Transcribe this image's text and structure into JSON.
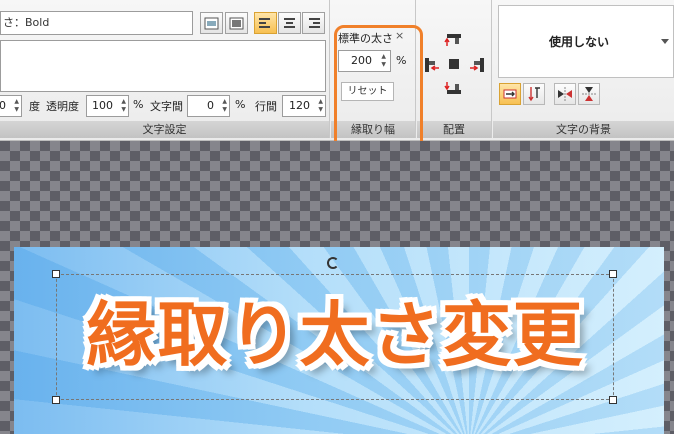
{
  "text_settings": {
    "font_value": "さ：Bold",
    "line3": {
      "angle_value": "0",
      "angle_unit": "度",
      "opacity_label": "透明度",
      "opacity_value": "100",
      "opacity_unit": "%",
      "spacing_label": "文字間",
      "spacing_value": "0",
      "spacing_unit": "%",
      "line_spacing_label": "行間",
      "line_spacing_value": "120"
    },
    "group_label": "文字設定"
  },
  "outline_width": {
    "title": "標準の太さ",
    "close": "×",
    "value": "200",
    "unit": "%",
    "reset_label": "リセット",
    "group_label": "縁取り幅"
  },
  "layout": {
    "group_label": "配置"
  },
  "text_background": {
    "selected": "使用しない",
    "group_label": "文字の背景"
  },
  "canvas": {
    "banner_text": "縁取り太さ変更"
  },
  "colors": {
    "accent_orange": "#f0802a",
    "text_orange": "#f06d1f",
    "active_button": "#f7c052"
  }
}
